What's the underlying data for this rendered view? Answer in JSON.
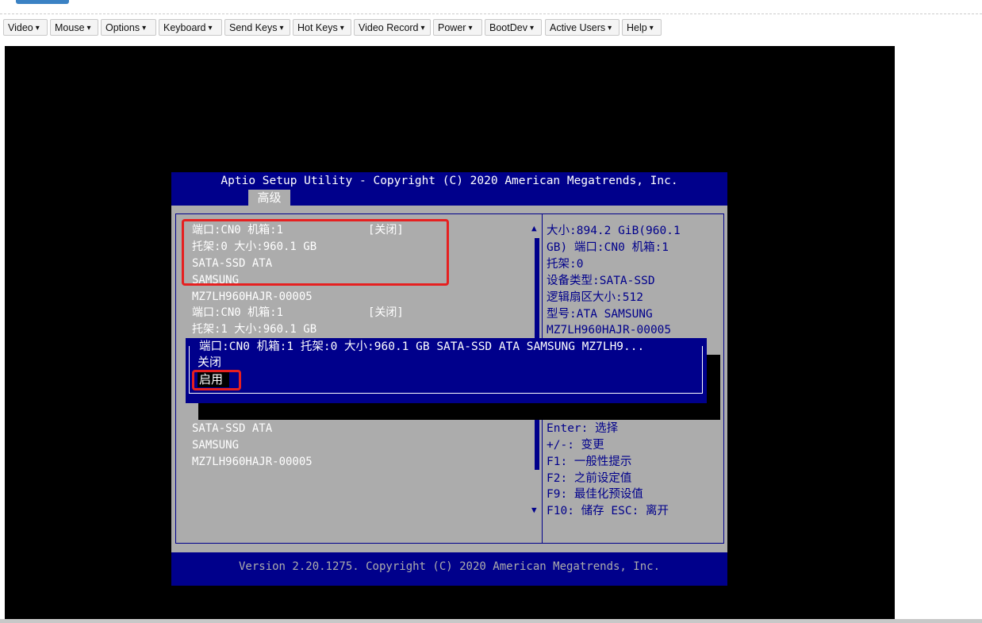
{
  "toolbar": {
    "menus": [
      {
        "label": "Video"
      },
      {
        "label": "Mouse"
      },
      {
        "label": "Options"
      },
      {
        "label": "Keyboard"
      },
      {
        "label": "Send Keys"
      },
      {
        "label": "Hot Keys"
      },
      {
        "label": "Video Record"
      },
      {
        "label": "Power"
      },
      {
        "label": "BootDev"
      },
      {
        "label": "Active Users"
      },
      {
        "label": "Help"
      }
    ],
    "caret": "▾"
  },
  "bios": {
    "title": "Aptio Setup Utility - Copyright (C) 2020 American Megatrends, Inc.",
    "tab": "高级",
    "left_items": [
      {
        "line1": "端口:CN0 机箱:1",
        "value": "[关闭]",
        "line2": "托架:0 大小:960.1 GB",
        "line3": "SATA-SSD ATA",
        "line4": "SAMSUNG",
        "line5": "MZ7LH960HAJR-00005"
      },
      {
        "line1": "端口:CN0 机箱:1",
        "value": "[关闭]",
        "line2": "托架:1 大小:960.1 GB",
        "line3": "SATA-SSD ATA",
        "line4": "SAMSUNG",
        "line5": "MZ7LH960HAJR-00005"
      }
    ],
    "help_text": [
      "大小:894.2 GiB(960.1",
      "GB) 端口:CN0 机箱:1",
      "托架:0",
      "设备类型:SATA-SSD",
      "逻辑扇区大小:512",
      "型号:ATA     SAMSUNG",
      "MZ7LH960HAJR-00005"
    ],
    "key_help": [
      "Enter: 选择",
      "+/-: 变更",
      "F1: 一般性提示",
      "F2: 之前设定值",
      "F9: 最佳化预设值",
      "F10: 储存  ESC: 离开"
    ],
    "scroll_up": "▲",
    "scroll_down": "▼",
    "footer": "Version 2.20.1275. Copyright (C) 2020 American Megatrends, Inc.",
    "popup": {
      "title": "端口:CN0 机箱:1 托架:0 大小:960.1 GB SATA-SSD ATA     SAMSUNG MZ7LH9...",
      "options": [
        "关闭",
        "启用"
      ],
      "selected": "启用"
    }
  },
  "colors": {
    "bios_blue": "#00008b",
    "bios_gray": "#acacac",
    "highlight_red": "#e62020"
  }
}
